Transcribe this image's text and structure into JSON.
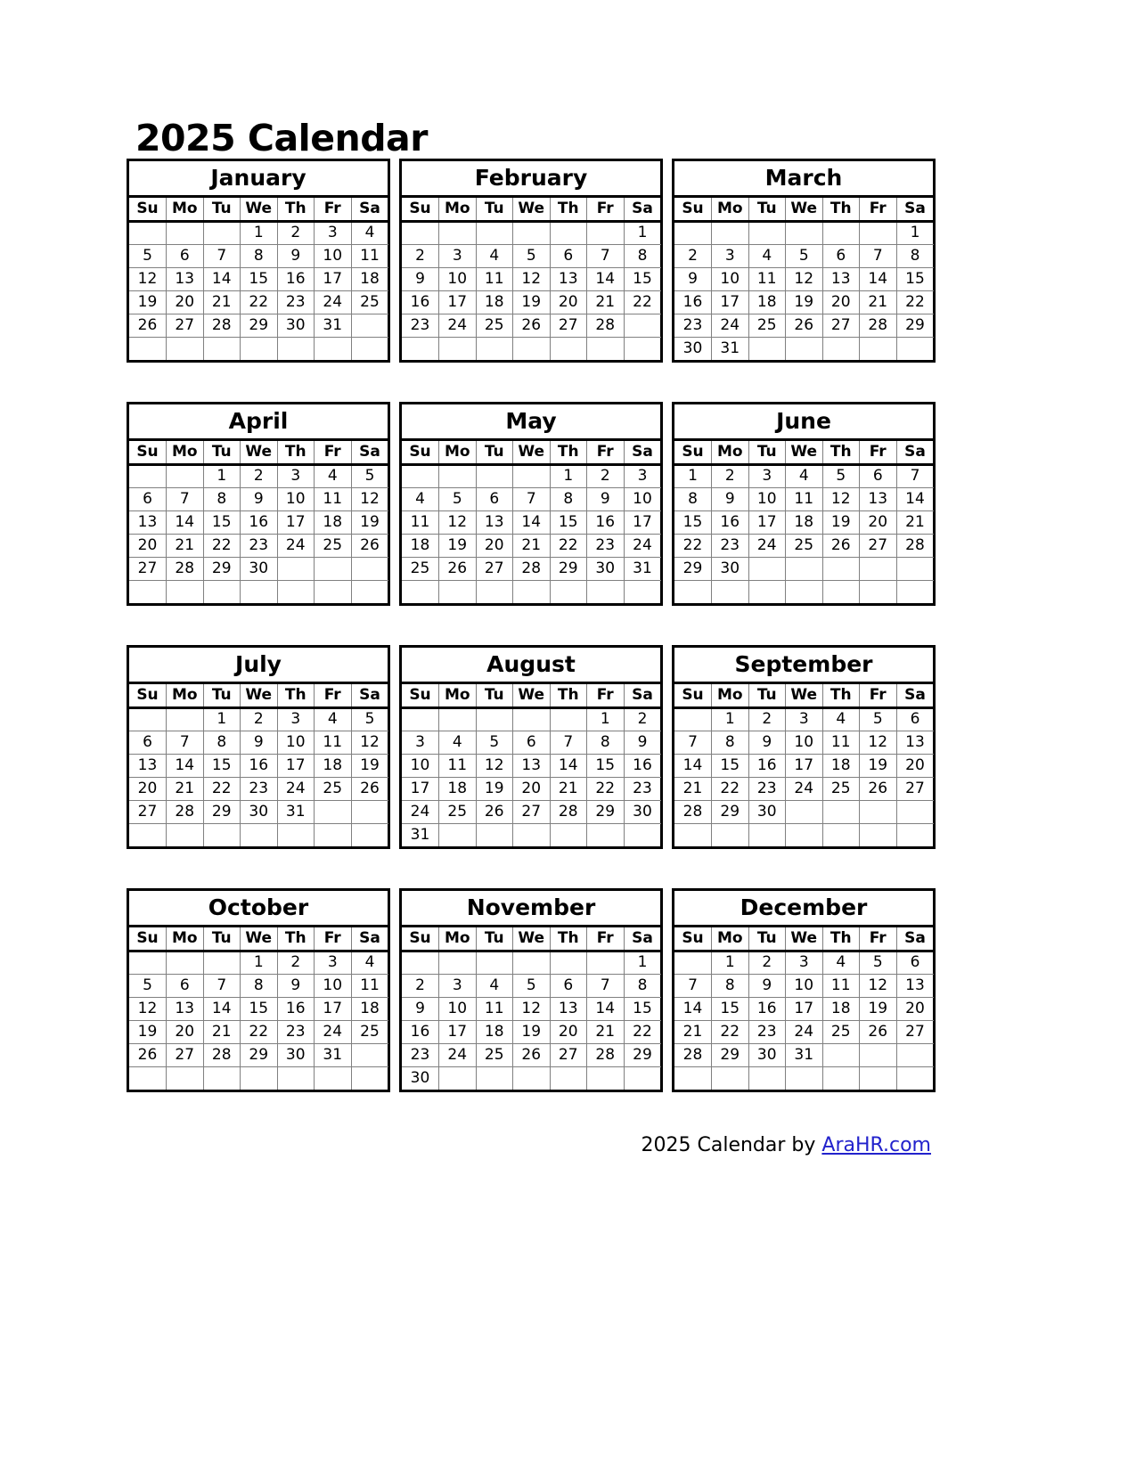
{
  "page_title": "2025 Calendar",
  "weekday_headers": [
    "Su",
    "Mo",
    "Tu",
    "We",
    "Th",
    "Fr",
    "Sa"
  ],
  "footer": {
    "year": "2025",
    "text": "Calendar by",
    "link_label": "AraHR.com",
    "link_color": "#2222cc"
  },
  "colors": {
    "card_border": "#000000",
    "cell_border": "#808080",
    "text": "#000000",
    "background": "#ffffff"
  },
  "chart_data": {
    "type": "table",
    "title": "2025 Calendar",
    "year": 2025,
    "week_start": "Sunday",
    "columns": [
      "Su",
      "Mo",
      "Tu",
      "We",
      "Th",
      "Fr",
      "Sa"
    ],
    "months": [
      {
        "name": "January",
        "index": 1,
        "days_in_month": 31,
        "first_weekday": "We",
        "weeks": [
          [
            "",
            "",
            "",
            "1",
            "2",
            "3",
            "4"
          ],
          [
            "5",
            "6",
            "7",
            "8",
            "9",
            "10",
            "11"
          ],
          [
            "12",
            "13",
            "14",
            "15",
            "16",
            "17",
            "18"
          ],
          [
            "19",
            "20",
            "21",
            "22",
            "23",
            "24",
            "25"
          ],
          [
            "26",
            "27",
            "28",
            "29",
            "30",
            "31",
            ""
          ],
          [
            "",
            "",
            "",
            "",
            "",
            "",
            ""
          ]
        ]
      },
      {
        "name": "February",
        "index": 2,
        "days_in_month": 28,
        "first_weekday": "Sa",
        "weeks": [
          [
            "",
            "",
            "",
            "",
            "",
            "",
            "1"
          ],
          [
            "2",
            "3",
            "4",
            "5",
            "6",
            "7",
            "8"
          ],
          [
            "9",
            "10",
            "11",
            "12",
            "13",
            "14",
            "15"
          ],
          [
            "16",
            "17",
            "18",
            "19",
            "20",
            "21",
            "22"
          ],
          [
            "23",
            "24",
            "25",
            "26",
            "27",
            "28",
            ""
          ],
          [
            "",
            "",
            "",
            "",
            "",
            "",
            ""
          ]
        ]
      },
      {
        "name": "March",
        "index": 3,
        "days_in_month": 31,
        "first_weekday": "Sa",
        "weeks": [
          [
            "",
            "",
            "",
            "",
            "",
            "",
            "1"
          ],
          [
            "2",
            "3",
            "4",
            "5",
            "6",
            "7",
            "8"
          ],
          [
            "9",
            "10",
            "11",
            "12",
            "13",
            "14",
            "15"
          ],
          [
            "16",
            "17",
            "18",
            "19",
            "20",
            "21",
            "22"
          ],
          [
            "23",
            "24",
            "25",
            "26",
            "27",
            "28",
            "29"
          ],
          [
            "30",
            "31",
            "",
            "",
            "",
            "",
            ""
          ]
        ]
      },
      {
        "name": "April",
        "index": 4,
        "days_in_month": 30,
        "first_weekday": "Tu",
        "weeks": [
          [
            "",
            "",
            "1",
            "2",
            "3",
            "4",
            "5"
          ],
          [
            "6",
            "7",
            "8",
            "9",
            "10",
            "11",
            "12"
          ],
          [
            "13",
            "14",
            "15",
            "16",
            "17",
            "18",
            "19"
          ],
          [
            "20",
            "21",
            "22",
            "23",
            "24",
            "25",
            "26"
          ],
          [
            "27",
            "28",
            "29",
            "30",
            "",
            "",
            ""
          ],
          [
            "",
            "",
            "",
            "",
            "",
            "",
            ""
          ]
        ]
      },
      {
        "name": "May",
        "index": 5,
        "days_in_month": 31,
        "first_weekday": "Th",
        "weeks": [
          [
            "",
            "",
            "",
            "",
            "1",
            "2",
            "3"
          ],
          [
            "4",
            "5",
            "6",
            "7",
            "8",
            "9",
            "10"
          ],
          [
            "11",
            "12",
            "13",
            "14",
            "15",
            "16",
            "17"
          ],
          [
            "18",
            "19",
            "20",
            "21",
            "22",
            "23",
            "24"
          ],
          [
            "25",
            "26",
            "27",
            "28",
            "29",
            "30",
            "31"
          ],
          [
            "",
            "",
            "",
            "",
            "",
            "",
            ""
          ]
        ]
      },
      {
        "name": "June",
        "index": 6,
        "days_in_month": 30,
        "first_weekday": "Su",
        "weeks": [
          [
            "1",
            "2",
            "3",
            "4",
            "5",
            "6",
            "7"
          ],
          [
            "8",
            "9",
            "10",
            "11",
            "12",
            "13",
            "14"
          ],
          [
            "15",
            "16",
            "17",
            "18",
            "19",
            "20",
            "21"
          ],
          [
            "22",
            "23",
            "24",
            "25",
            "26",
            "27",
            "28"
          ],
          [
            "29",
            "30",
            "",
            "",
            "",
            "",
            ""
          ],
          [
            "",
            "",
            "",
            "",
            "",
            "",
            ""
          ]
        ]
      },
      {
        "name": "July",
        "index": 7,
        "days_in_month": 31,
        "first_weekday": "Tu",
        "weeks": [
          [
            "",
            "",
            "1",
            "2",
            "3",
            "4",
            "5"
          ],
          [
            "6",
            "7",
            "8",
            "9",
            "10",
            "11",
            "12"
          ],
          [
            "13",
            "14",
            "15",
            "16",
            "17",
            "18",
            "19"
          ],
          [
            "20",
            "21",
            "22",
            "23",
            "24",
            "25",
            "26"
          ],
          [
            "27",
            "28",
            "29",
            "30",
            "31",
            "",
            ""
          ],
          [
            "",
            "",
            "",
            "",
            "",
            "",
            ""
          ]
        ]
      },
      {
        "name": "August",
        "index": 8,
        "days_in_month": 31,
        "first_weekday": "Fr",
        "weeks": [
          [
            "",
            "",
            "",
            "",
            "",
            "1",
            "2"
          ],
          [
            "3",
            "4",
            "5",
            "6",
            "7",
            "8",
            "9"
          ],
          [
            "10",
            "11",
            "12",
            "13",
            "14",
            "15",
            "16"
          ],
          [
            "17",
            "18",
            "19",
            "20",
            "21",
            "22",
            "23"
          ],
          [
            "24",
            "25",
            "26",
            "27",
            "28",
            "29",
            "30"
          ],
          [
            "31",
            "",
            "",
            "",
            "",
            "",
            ""
          ]
        ]
      },
      {
        "name": "September",
        "index": 9,
        "days_in_month": 30,
        "first_weekday": "Mo",
        "weeks": [
          [
            "",
            "1",
            "2",
            "3",
            "4",
            "5",
            "6"
          ],
          [
            "7",
            "8",
            "9",
            "10",
            "11",
            "12",
            "13"
          ],
          [
            "14",
            "15",
            "16",
            "17",
            "18",
            "19",
            "20"
          ],
          [
            "21",
            "22",
            "23",
            "24",
            "25",
            "26",
            "27"
          ],
          [
            "28",
            "29",
            "30",
            "",
            "",
            "",
            ""
          ],
          [
            "",
            "",
            "",
            "",
            "",
            "",
            ""
          ]
        ]
      },
      {
        "name": "October",
        "index": 10,
        "days_in_month": 31,
        "first_weekday": "We",
        "weeks": [
          [
            "",
            "",
            "",
            "1",
            "2",
            "3",
            "4"
          ],
          [
            "5",
            "6",
            "7",
            "8",
            "9",
            "10",
            "11"
          ],
          [
            "12",
            "13",
            "14",
            "15",
            "16",
            "17",
            "18"
          ],
          [
            "19",
            "20",
            "21",
            "22",
            "23",
            "24",
            "25"
          ],
          [
            "26",
            "27",
            "28",
            "29",
            "30",
            "31",
            ""
          ],
          [
            "",
            "",
            "",
            "",
            "",
            "",
            ""
          ]
        ]
      },
      {
        "name": "November",
        "index": 11,
        "days_in_month": 30,
        "first_weekday": "Sa",
        "weeks": [
          [
            "",
            "",
            "",
            "",
            "",
            "",
            "1"
          ],
          [
            "2",
            "3",
            "4",
            "5",
            "6",
            "7",
            "8"
          ],
          [
            "9",
            "10",
            "11",
            "12",
            "13",
            "14",
            "15"
          ],
          [
            "16",
            "17",
            "18",
            "19",
            "20",
            "21",
            "22"
          ],
          [
            "23",
            "24",
            "25",
            "26",
            "27",
            "28",
            "29"
          ],
          [
            "30",
            "",
            "",
            "",
            "",
            "",
            ""
          ]
        ]
      },
      {
        "name": "December",
        "index": 12,
        "days_in_month": 31,
        "first_weekday": "Mo",
        "weeks": [
          [
            "",
            "1",
            "2",
            "3",
            "4",
            "5",
            "6"
          ],
          [
            "7",
            "8",
            "9",
            "10",
            "11",
            "12",
            "13"
          ],
          [
            "14",
            "15",
            "16",
            "17",
            "18",
            "19",
            "20"
          ],
          [
            "21",
            "22",
            "23",
            "24",
            "25",
            "26",
            "27"
          ],
          [
            "28",
            "29",
            "30",
            "31",
            "",
            "",
            ""
          ],
          [
            "",
            "",
            "",
            "",
            "",
            "",
            ""
          ]
        ]
      }
    ]
  }
}
